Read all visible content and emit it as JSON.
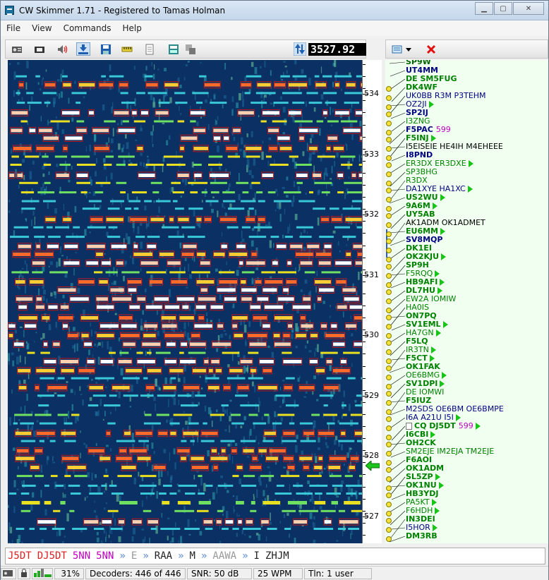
{
  "window": {
    "title": "CW Skimmer 1.71 - Registered to Tamas Holman"
  },
  "menu": [
    "File",
    "View",
    "Commands",
    "Help"
  ],
  "toolbar": {
    "frequency": "3527.92",
    "icons": [
      "radio-icon",
      "soundcard-icon",
      "speaker-icon",
      "download-icon",
      "save-icon",
      "ruler-icon",
      "notepad-icon",
      "tile-icon",
      "cascade-icon"
    ]
  },
  "right_toolbar": {
    "icons": [
      "call-list-icon",
      "dropdown-arrow-icon",
      "clear-icon"
    ]
  },
  "scale": {
    "labels": [
      "534",
      "533",
      "532",
      "531",
      "530",
      "529",
      "528",
      "527"
    ]
  },
  "calls": [
    {
      "text": "SP9W",
      "color": "#006400",
      "bold": true,
      "play": false,
      "coin": false
    },
    {
      "text": "UT4MM",
      "color": "#000080",
      "bold": true,
      "play": false,
      "coin": false
    },
    {
      "text": "DE SM5FUG",
      "color": "#008000",
      "bold": true,
      "play": false,
      "coin": false
    },
    {
      "text": "DK4WF",
      "color": "#008000",
      "bold": true,
      "play": false,
      "coin": true
    },
    {
      "text": "UK0BB R3M P3TEHM",
      "color": "#000080",
      "bold": false,
      "play": false,
      "coin": true
    },
    {
      "text": "OZ2JI",
      "color": "#000080",
      "bold": false,
      "play": true,
      "coin": true
    },
    {
      "text": "SP2IJ",
      "color": "#000080",
      "bold": true,
      "play": false,
      "coin": true
    },
    {
      "text": "I3ZNG",
      "color": "#008000",
      "bold": false,
      "play": false,
      "coin": true
    },
    {
      "text": "F5PAC",
      "color": "#000080",
      "bold": true,
      "rst": "599",
      "play": false,
      "coin": true
    },
    {
      "text": "F5INJ",
      "color": "#008000",
      "bold": true,
      "play": true,
      "coin": true
    },
    {
      "text": "I5EISEIE HE4IH M4EHEEE",
      "color": "#000000",
      "bold": false,
      "play": false,
      "coin": true
    },
    {
      "text": "I8PND",
      "color": "#000080",
      "bold": true,
      "play": false,
      "coin": true
    },
    {
      "text": "ER3DX ER3DXE",
      "color": "#008000",
      "bold": false,
      "play": true,
      "coin": true
    },
    {
      "text": "SP3BHG",
      "color": "#008000",
      "bold": false,
      "play": false,
      "coin": true
    },
    {
      "text": "R3DX",
      "color": "#008000",
      "bold": false,
      "play": false,
      "coin": true
    },
    {
      "text": "DA1XYE HA1XC",
      "color": "#000080",
      "bold": false,
      "play": true,
      "coin": true
    },
    {
      "text": "US2WU",
      "color": "#008000",
      "bold": true,
      "play": true,
      "coin": true
    },
    {
      "text": "9A6M",
      "color": "#008000",
      "bold": true,
      "play": true,
      "coin": true
    },
    {
      "text": "UY5AB",
      "color": "#008000",
      "bold": true,
      "play": false,
      "coin": true
    },
    {
      "text": "AK1ADM OK1ADMET",
      "color": "#000000",
      "bold": false,
      "play": false,
      "coin": true
    },
    {
      "text": "EU6MM",
      "color": "#008000",
      "bold": true,
      "play": true,
      "coin": true
    },
    {
      "text": "SV8MQP",
      "color": "#000080",
      "bold": true,
      "play": false,
      "coin": true
    },
    {
      "text": "DK1EI",
      "color": "#008000",
      "bold": true,
      "play": false,
      "coin": true
    },
    {
      "text": "OK2KJU",
      "color": "#008000",
      "bold": true,
      "play": true,
      "coin": true
    },
    {
      "text": "SP9H",
      "color": "#008000",
      "bold": true,
      "play": false,
      "coin": true
    },
    {
      "text": "F5RQQ",
      "color": "#008000",
      "bold": false,
      "play": true,
      "coin": true
    },
    {
      "text": "HB9AFI",
      "color": "#008000",
      "bold": true,
      "play": true,
      "coin": true
    },
    {
      "text": "DL7HU",
      "color": "#008000",
      "bold": true,
      "play": true,
      "coin": true
    },
    {
      "text": "EW2A IOMIW",
      "color": "#008000",
      "bold": false,
      "play": false,
      "coin": true
    },
    {
      "text": "HA0IS",
      "color": "#008000",
      "bold": false,
      "play": false,
      "coin": true
    },
    {
      "text": "ON7PQ",
      "color": "#008000",
      "bold": true,
      "play": false,
      "coin": true
    },
    {
      "text": "SV1EML",
      "color": "#008000",
      "bold": true,
      "play": true,
      "coin": true
    },
    {
      "text": "HA7GN",
      "color": "#008000",
      "bold": false,
      "play": true,
      "coin": true
    },
    {
      "text": "F5LQ",
      "color": "#008000",
      "bold": true,
      "play": false,
      "coin": true
    },
    {
      "text": "IR3TN",
      "color": "#008000",
      "bold": false,
      "play": true,
      "coin": true
    },
    {
      "text": "F5CT",
      "color": "#008000",
      "bold": true,
      "play": true,
      "coin": true
    },
    {
      "text": "OK1FAK",
      "color": "#008000",
      "bold": true,
      "play": false,
      "coin": true
    },
    {
      "text": "OE6BMG",
      "color": "#008000",
      "bold": false,
      "play": true,
      "coin": true
    },
    {
      "text": "SV1DPI",
      "color": "#008000",
      "bold": true,
      "play": true,
      "coin": true
    },
    {
      "text": "DE IOMWI",
      "color": "#008000",
      "bold": false,
      "play": false,
      "coin": true
    },
    {
      "text": "F5IUZ",
      "color": "#008000",
      "bold": true,
      "play": false,
      "coin": true
    },
    {
      "text": "M2SDS OE6BM OE6BMPE",
      "color": "#000080",
      "bold": false,
      "play": false,
      "coin": true
    },
    {
      "text": "I6A A21U I5I",
      "color": "#000080",
      "bold": false,
      "play": true,
      "coin": true
    },
    {
      "text": "CQ DJ5DT",
      "color": "#008000",
      "bold": true,
      "rst": "599",
      "play": true,
      "coin": true,
      "note": true
    },
    {
      "text": "I6CBI",
      "color": "#008000",
      "bold": true,
      "play": true,
      "coin": true
    },
    {
      "text": "OH2CK",
      "color": "#008000",
      "bold": true,
      "play": false,
      "coin": true
    },
    {
      "text": "SM2EJE IM2EJA TM2EJE",
      "color": "#008000",
      "bold": false,
      "play": false,
      "coin": true
    },
    {
      "text": "F6AOI",
      "color": "#008000",
      "bold": true,
      "play": false,
      "coin": true
    },
    {
      "text": "OK1ADM",
      "color": "#008000",
      "bold": true,
      "play": false,
      "coin": true
    },
    {
      "text": "SL5ZP",
      "color": "#008000",
      "bold": true,
      "play": true,
      "coin": true
    },
    {
      "text": "OK1NU",
      "color": "#008000",
      "bold": true,
      "play": true,
      "coin": true
    },
    {
      "text": "HB3YDJ",
      "color": "#008000",
      "bold": true,
      "play": false,
      "coin": true
    },
    {
      "text": "PA5KT",
      "color": "#008000",
      "bold": false,
      "play": true,
      "coin": true
    },
    {
      "text": "F6HDH",
      "color": "#008000",
      "bold": false,
      "play": true,
      "coin": true
    },
    {
      "text": "IN3DEI",
      "color": "#008000",
      "bold": true,
      "play": false,
      "coin": true
    },
    {
      "text": "I5HOR",
      "color": "#000080",
      "bold": false,
      "play": true,
      "coin": true
    },
    {
      "text": "DM3RB",
      "color": "#008000",
      "bold": true,
      "play": false,
      "coin": true
    }
  ],
  "decoded_line": [
    {
      "text": "J5DT",
      "color": "#e02020"
    },
    {
      "text": "DJ5DT",
      "color": "#e02020"
    },
    {
      "text": "5NN",
      "color": "#c000c0"
    },
    {
      "text": "5NN",
      "color": "#c000c0"
    },
    {
      "text": "»",
      "color": "#5a8ad0"
    },
    {
      "text": "E",
      "color": "#999999"
    },
    {
      "text": "»",
      "color": "#5a8ad0"
    },
    {
      "text": "RAA",
      "color": "#222222"
    },
    {
      "text": "»",
      "color": "#5a8ad0"
    },
    {
      "text": "M",
      "color": "#222222"
    },
    {
      "text": "»",
      "color": "#5a8ad0"
    },
    {
      "text": "AAWA",
      "color": "#999999"
    },
    {
      "text": "»",
      "color": "#5a8ad0"
    },
    {
      "text": "I",
      "color": "#222222"
    },
    {
      "text": "ZHJM",
      "color": "#222222"
    }
  ],
  "status": {
    "cpu": "31%",
    "decoders": "Decoders: 446 of 446",
    "snr": "SNR: 50 dB",
    "wpm": "25 WPM",
    "tln": "Tln: 1 user"
  }
}
